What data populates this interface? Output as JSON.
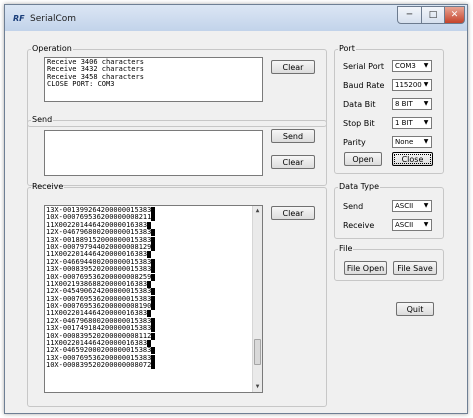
{
  "window": {
    "title": "SerialCom",
    "app_icon": "RF",
    "min_icon": "minimize-icon",
    "max_icon": "maximize-icon",
    "close_icon": "close-icon"
  },
  "operation": {
    "legend": "Operation",
    "lines": [
      "Receive 3406 characters",
      "Receive 3432 characters",
      "Receive 3458 characters",
      "CLOSE PORT: COM3"
    ],
    "clear_label": "Clear"
  },
  "send": {
    "legend": "Send",
    "value": "",
    "send_label": "Send",
    "clear_label": "Clear"
  },
  "receive": {
    "legend": "Receive",
    "clear_label": "Clear",
    "lines": [
      "13X-001399264200000015383",
      "10X-000769536200000008211",
      "11X002201446420000016383",
      "12X-046796800200000015383",
      "13X-001889152000000015383",
      "10X-000797944020000008129",
      "11X002201446420000016383",
      "12X-046694400200000015383",
      "13X-000839520200000015383",
      "10X-000769536200000008259",
      "11X002193868820000016383",
      "12X-045490624200000015383",
      "13X-000769536200000015383",
      "10X-000769536200000008190",
      "11X002201446420000016383",
      "12X-046796800200000015383",
      "13X-001749184200000015383",
      "10X-000839520200000008112",
      "11X002201446420000016383",
      "12X-046592000200000015383",
      "13X-000769536200000015383",
      "10X-000839520200000008072"
    ]
  },
  "port": {
    "legend": "Port",
    "rows": [
      {
        "label": "Serial Port",
        "value": "COM3"
      },
      {
        "label": "Baud Rate",
        "value": "115200"
      },
      {
        "label": "Data Bit",
        "value": "8 BIT"
      },
      {
        "label": "Stop Bit",
        "value": "1 BIT"
      },
      {
        "label": "Parity",
        "value": "None"
      }
    ],
    "open_label": "Open",
    "close_label": "Close"
  },
  "data_type": {
    "legend": "Data Type",
    "rows": [
      {
        "label": "Send",
        "value": "ASCII"
      },
      {
        "label": "Receive",
        "value": "ASCII"
      }
    ]
  },
  "file": {
    "legend": "File",
    "open_label": "File Open",
    "save_label": "File Save"
  },
  "quit_label": "Quit"
}
